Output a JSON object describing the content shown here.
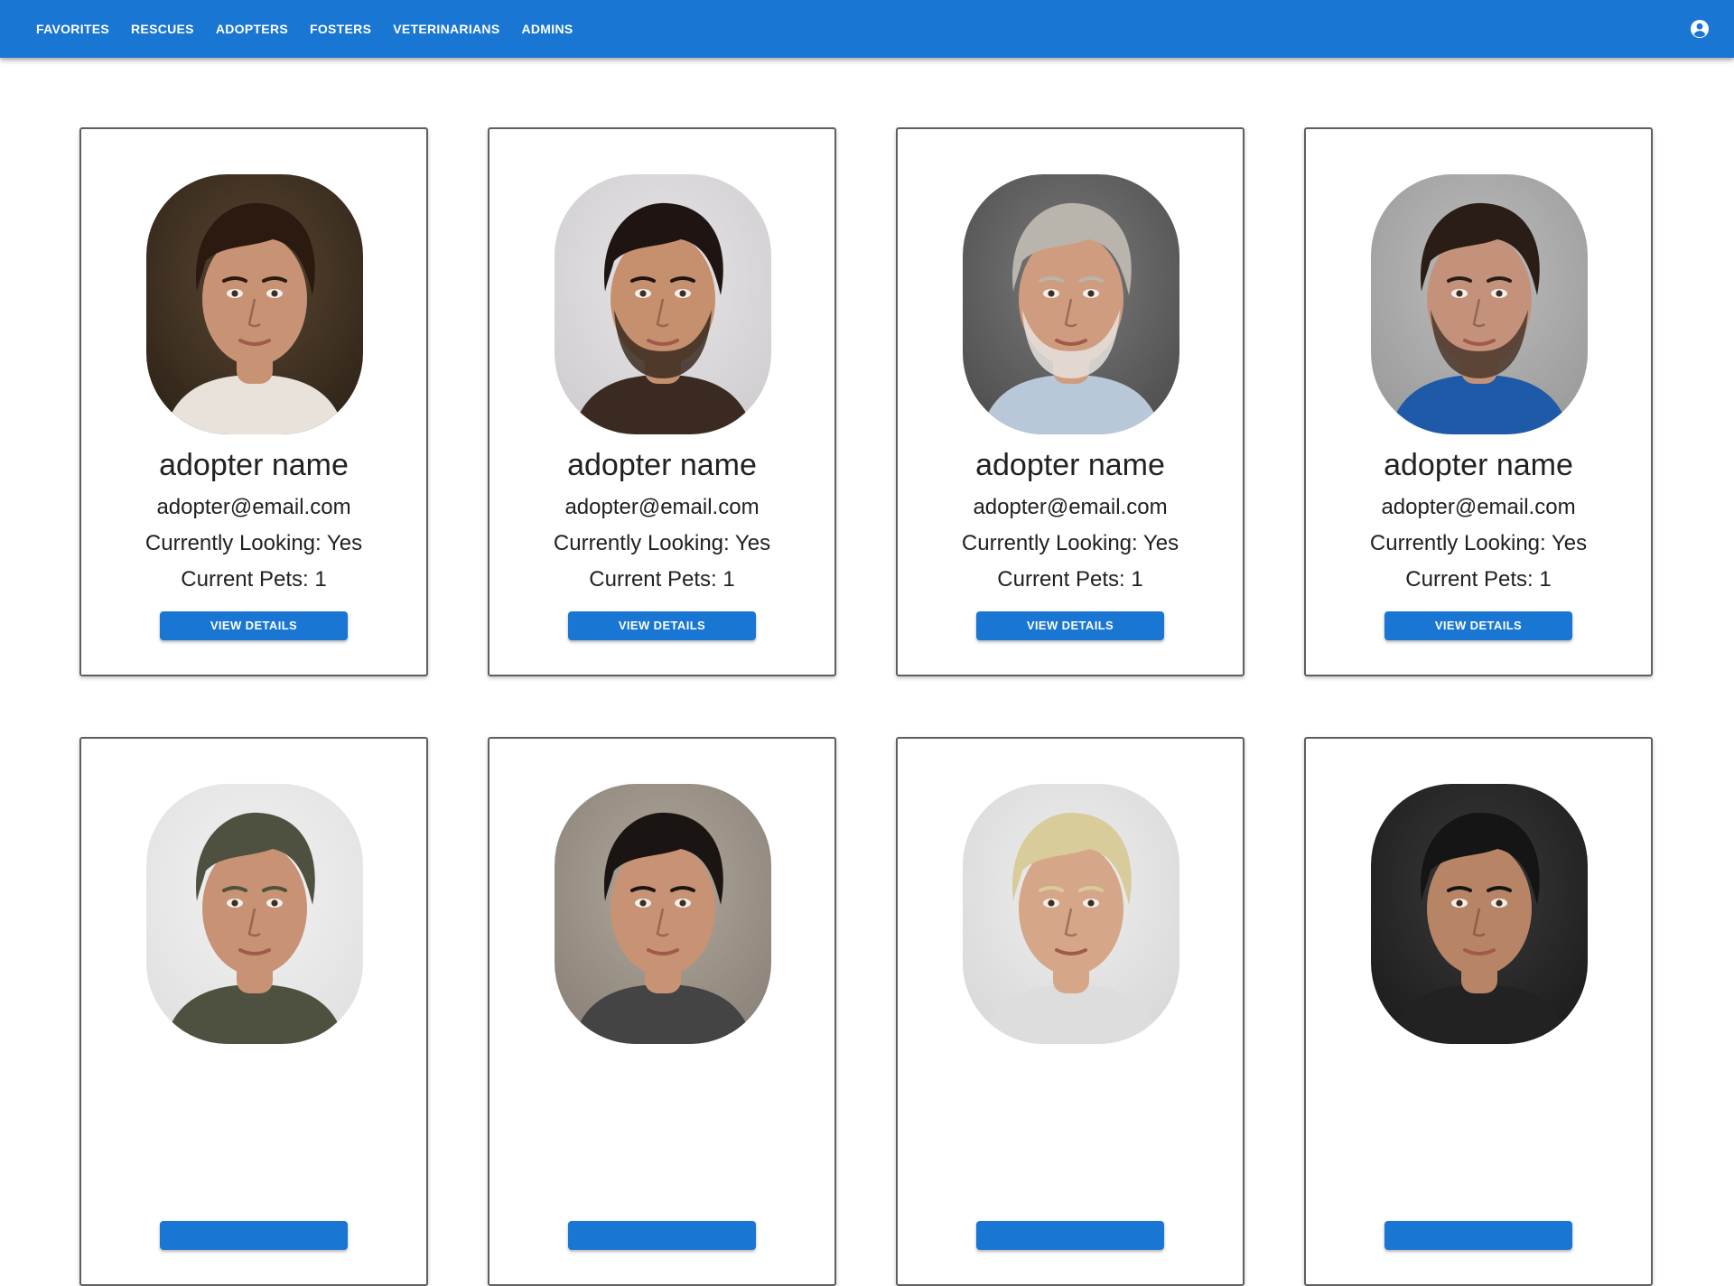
{
  "nav": {
    "items": [
      "FAVORITES",
      "RESCUES",
      "ADOPTERS",
      "FOSTERS",
      "VETERINARIANS",
      "ADMINS"
    ],
    "account_icon": "account-circle-icon"
  },
  "colors": {
    "primary": "#1976d2",
    "card_border": "#5f5f5f"
  },
  "cards": [
    {
      "name": "adopter name",
      "email": "adopter@email.com",
      "looking": "Currently Looking: Yes",
      "pets": "Current Pets: 1",
      "button": "VIEW DETAILS"
    },
    {
      "name": "adopter name",
      "email": "adopter@email.com",
      "looking": "Currently Looking: Yes",
      "pets": "Current Pets: 1",
      "button": "VIEW DETAILS"
    },
    {
      "name": "adopter name",
      "email": "adopter@email.com",
      "looking": "Currently Looking: Yes",
      "pets": "Current Pets: 1",
      "button": "VIEW DETAILS"
    },
    {
      "name": "adopter name",
      "email": "adopter@email.com",
      "looking": "Currently Looking: Yes",
      "pets": "Current Pets: 1",
      "button": "VIEW DETAILS"
    },
    {
      "name": "",
      "email": "",
      "looking": "",
      "pets": "",
      "button": ""
    },
    {
      "name": "",
      "email": "",
      "looking": "",
      "pets": "",
      "button": ""
    },
    {
      "name": "",
      "email": "",
      "looking": "",
      "pets": "",
      "button": ""
    },
    {
      "name": "",
      "email": "",
      "looking": "",
      "pets": "",
      "button": ""
    }
  ]
}
